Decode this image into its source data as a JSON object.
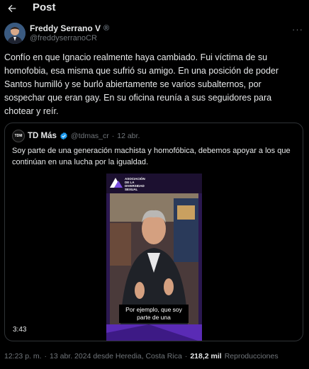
{
  "header": {
    "title": "Post"
  },
  "author": {
    "name": "Freddy Serrano V",
    "badge": "®",
    "handle": "@freddyserranoCR",
    "more": "···"
  },
  "tweet": {
    "text": "Confío en que Ignacio realmente haya cambiado. Fui víctima de su homofobia, esa misma que sufrió su amigo. En una posición de poder Santos humilló y se burló abiertamente se varios subalternos, por sospechar que eran gay. En su oficina reunía a sus seguidores para chotear y reír."
  },
  "quote": {
    "avatar_text": "TDM",
    "name": "TD Más",
    "handle": "@tdmas_cr",
    "dot": "·",
    "date": "12 abr.",
    "text": "Soy parte de una generación machista y homofóbica, debemos apoyar a los que continúan en una lucha por la igualdad.",
    "video": {
      "logo_text": "ASOCIACIÓN\nDE LA\nDIVERSIDAD\nSEXUAL",
      "caption": "Por ejemplo, que soy parte de una",
      "duration": "3:43"
    }
  },
  "meta": {
    "time": "12:23 p. m.",
    "sep1": "·",
    "date_place": "13 abr. 2024 desde Heredia, Costa Rica",
    "sep2": "·",
    "views": "218,2 mil",
    "views_label": "Reproducciones"
  },
  "colors": {
    "background": "#000000",
    "text": "#e7e9ea",
    "secondary": "#71767b",
    "border": "#2f3336",
    "verified": "#1d9bf0",
    "video_purple": "#5b2bb5"
  },
  "icons": [
    "back-arrow-icon",
    "registered-badge-icon",
    "more-icon",
    "verified-icon"
  ]
}
